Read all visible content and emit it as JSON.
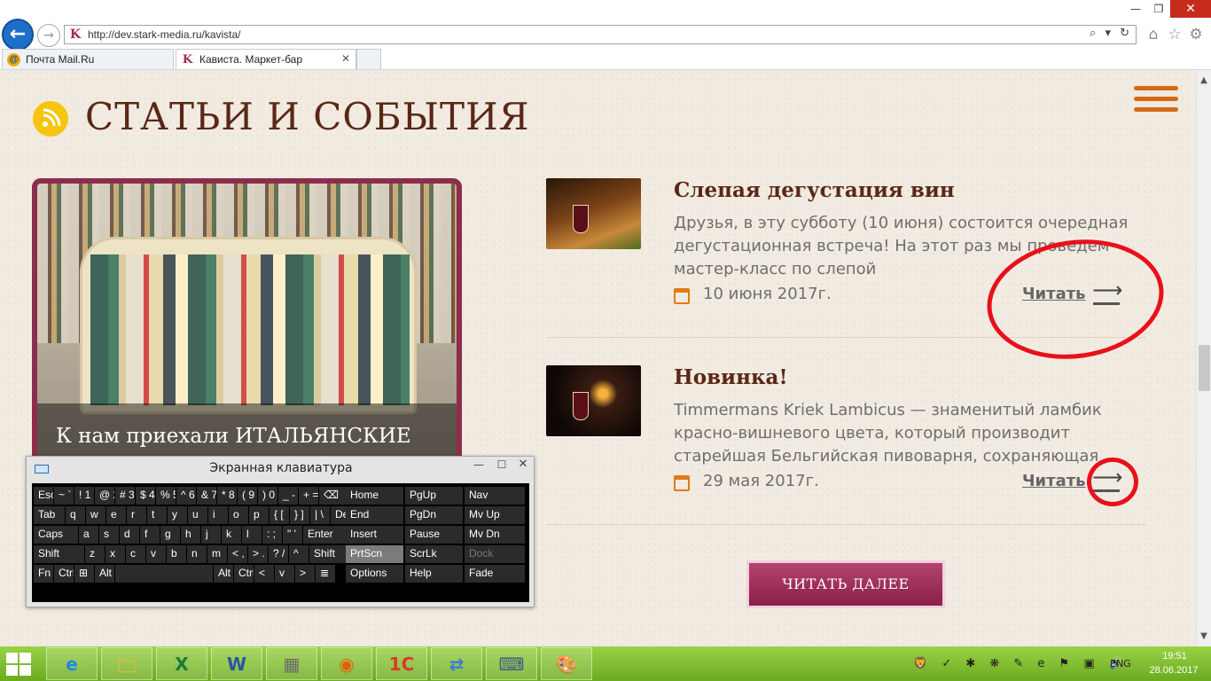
{
  "browser": {
    "url": "http://dev.stark-media.ru/kavista/",
    "address_tools": "⌕ ▾ ↻",
    "tabs": [
      {
        "label": "Почта Mail.Ru"
      },
      {
        "label": "Кависта. Маркет-бар"
      }
    ],
    "window_buttons": {
      "minimize": "—",
      "maximize": "❐",
      "close": "✕"
    },
    "icons": {
      "back": "back-arrow-icon",
      "forward": "forward-arrow-icon",
      "home": "home-icon",
      "favorites": "star-icon",
      "tools": "gear-icon"
    }
  },
  "page": {
    "section_title": "СТАТЬИ И СОБЫТИЯ",
    "featured_caption": "К нам приехали ИТАЛЬЯНСКИЕ",
    "articles": [
      {
        "title": "Слепая дегустация вин",
        "text": "Друзья, в эту субботу (10 июня) состоится очередная дегустационная встреча! На этот раз мы проведем мастер-класс по слепой",
        "date": "10 июня 2017г.",
        "read": "Читать"
      },
      {
        "title": "Новинка!",
        "text": "Timmermans Kriek Lambicus — знаменитый ламбик красно-вишневого цвета, который производит старейшая Бельгийская пивоварня, сохраняющая",
        "date": "29 мая 2017г.",
        "read": "Читать"
      }
    ],
    "read_more": "ЧИТАТЬ ДАЛЕЕ",
    "colors": {
      "accent_orange": "#d46a16",
      "title_brown": "#5a2716",
      "button_purple": "#8a1f48",
      "annotation_red": "#e8101a"
    }
  },
  "osk": {
    "title": "Экранная клавиатура",
    "rows": [
      [
        "Esc",
        "~ `",
        "! 1",
        "@ 2",
        "# 3",
        "$ 4",
        "% 5",
        "^ 6",
        "& 7",
        "* 8",
        "( 9",
        ") 0",
        "_ -",
        "+ =",
        "⌫"
      ],
      [
        "Tab",
        "q",
        "w",
        "e",
        "r",
        "t",
        "y",
        "u",
        "i",
        "o",
        "p",
        "{ [",
        "} ]",
        "| \\",
        "Del"
      ],
      [
        "Caps",
        "a",
        "s",
        "d",
        "f",
        "g",
        "h",
        "j",
        "k",
        "l",
        ": ;",
        "\" '",
        "Enter"
      ],
      [
        "Shift",
        "z",
        "x",
        "c",
        "v",
        "b",
        "n",
        "m",
        "< ,",
        "> .",
        "? /",
        "^",
        "Shift"
      ],
      [
        "Fn",
        "Ctrl",
        "⊞",
        "Alt",
        "",
        "Alt",
        "Ctrl",
        "<",
        "v",
        ">",
        "≣"
      ]
    ],
    "side": [
      [
        "Home",
        "PgUp",
        "Nav"
      ],
      [
        "End",
        "PgDn",
        "Mv Up"
      ],
      [
        "Insert",
        "Pause",
        "Mv Dn"
      ],
      [
        "PrtScn",
        "ScrLk",
        "Dock"
      ],
      [
        "Options",
        "Help",
        "Fade"
      ]
    ]
  },
  "taskbar": {
    "apps": [
      "e",
      "🗀",
      "X",
      "W",
      "▦",
      "◉",
      "1С",
      "⇄",
      "⌨",
      "🎨"
    ],
    "tray_icons": "🦁 ✓ ✱ ❋ ✎ e ⚑ ▣ 🔊",
    "lang": "ENG",
    "time": "19:51",
    "date": "28.06.2017"
  }
}
